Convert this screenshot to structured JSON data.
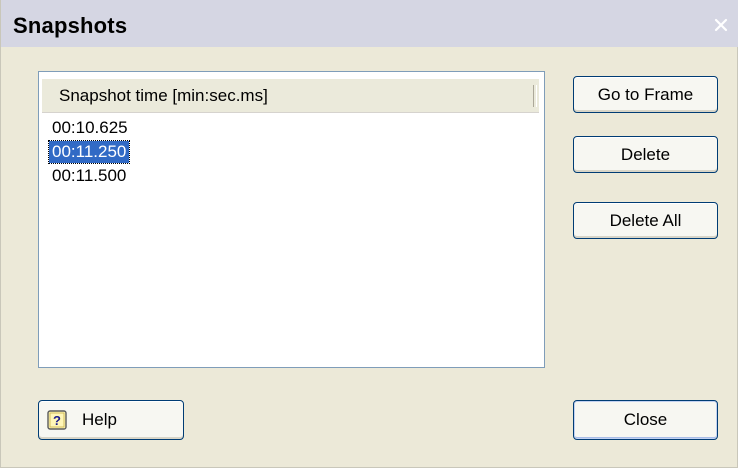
{
  "window": {
    "title": "Snapshots"
  },
  "list": {
    "column_header": "Snapshot time [min:sec.ms]",
    "rows": [
      {
        "time": "00:10.625",
        "selected": false
      },
      {
        "time": "00:11.250",
        "selected": true
      },
      {
        "time": "00:11.500",
        "selected": false
      }
    ]
  },
  "buttons": {
    "go_to_frame": "Go to Frame",
    "delete": "Delete",
    "delete_all": "Delete All",
    "help": "Help",
    "close": "Close"
  },
  "colors": {
    "title_bar": "#d5d6e3",
    "dialog_bg": "#ece9d8",
    "selection": "#316ac5",
    "button_border": "#003c74"
  },
  "icons": {
    "close": "close-x-icon",
    "help": "help-question-icon"
  }
}
